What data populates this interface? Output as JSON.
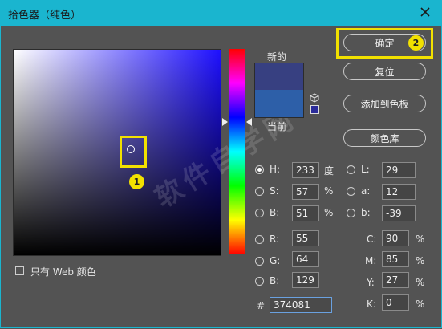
{
  "window": {
    "title": "拾色器（纯色）"
  },
  "preview": {
    "new_label": "新的",
    "current_label": "当前",
    "new_color": "#374081",
    "current_color": "#2d5fa8"
  },
  "buttons": {
    "ok": "确定",
    "reset": "复位",
    "add_swatch": "添加到色板",
    "libraries": "颜色库"
  },
  "web_only": {
    "label": "只有 Web 颜色",
    "checked": false
  },
  "hsb": {
    "h": {
      "label": "H:",
      "value": "233",
      "unit": "度"
    },
    "s": {
      "label": "S:",
      "value": "57",
      "unit": "%"
    },
    "b": {
      "label": "B:",
      "value": "51",
      "unit": "%"
    }
  },
  "lab": {
    "l": {
      "label": "L:",
      "value": "29"
    },
    "a": {
      "label": "a:",
      "value": "12"
    },
    "b": {
      "label": "b:",
      "value": "-39"
    }
  },
  "rgb": {
    "r": {
      "label": "R:",
      "value": "55"
    },
    "g": {
      "label": "G:",
      "value": "64"
    },
    "b": {
      "label": "B:",
      "value": "129"
    }
  },
  "cmyk": {
    "c": {
      "label": "C:",
      "value": "90",
      "unit": "%"
    },
    "m": {
      "label": "M:",
      "value": "85",
      "unit": "%"
    },
    "y": {
      "label": "Y:",
      "value": "27",
      "unit": "%"
    },
    "k": {
      "label": "K:",
      "value": "0",
      "unit": "%"
    }
  },
  "hex": {
    "label": "#",
    "value": "374081"
  },
  "annotations": {
    "one": "1",
    "two": "2"
  },
  "watermark": {
    "text": "软件自学网"
  },
  "colors": {
    "titlebar": "#1ab5cf",
    "highlight": "#f2e100",
    "panel": "#535353"
  }
}
